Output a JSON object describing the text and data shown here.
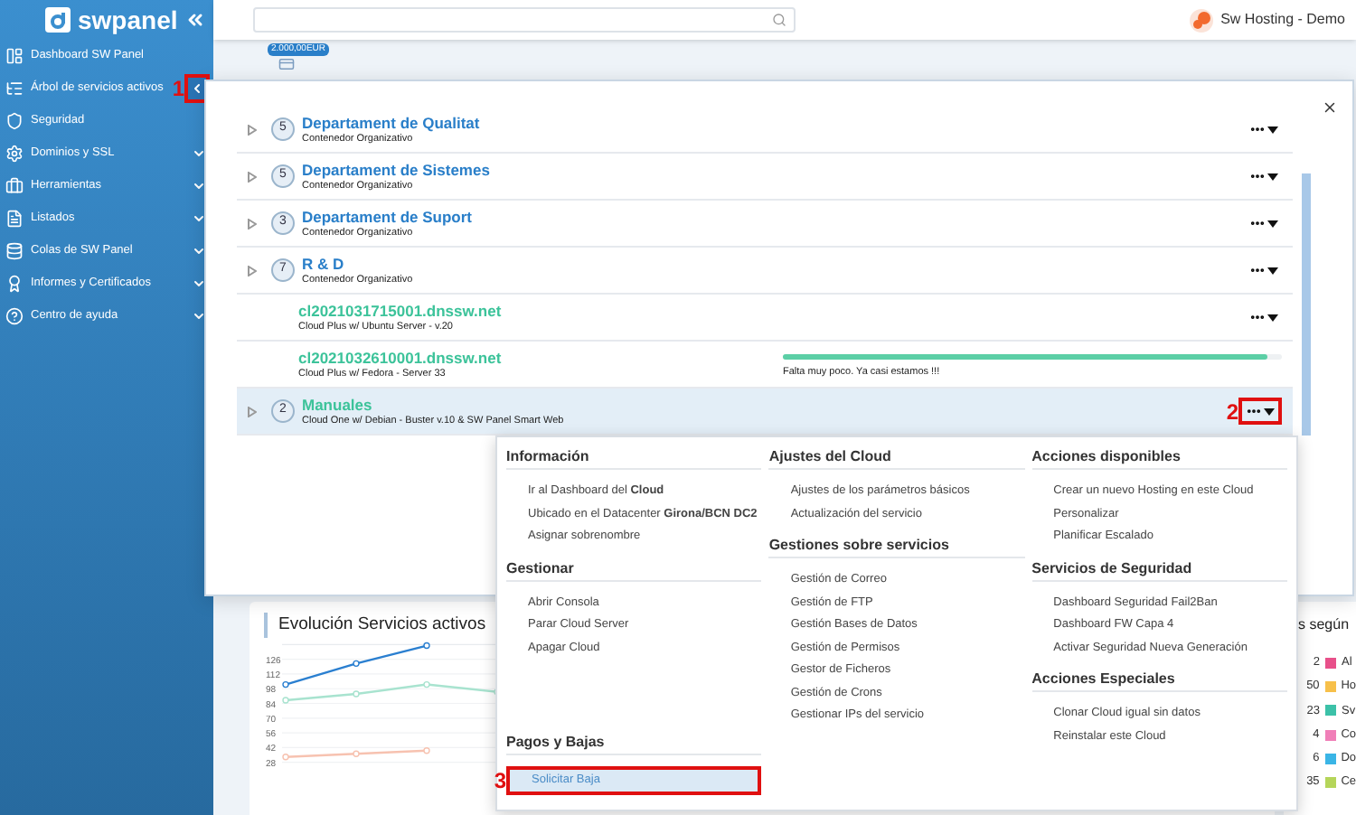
{
  "sidebar": {
    "logo": "swpanel",
    "items": [
      {
        "label": "Dashboard SW Panel",
        "expandable": false
      },
      {
        "label": "Árbol de servicios activos",
        "expandable": false,
        "annotation": "1"
      },
      {
        "label": "Seguridad",
        "expandable": false
      },
      {
        "label": "Dominios y SSL",
        "expandable": true
      },
      {
        "label": "Herramientas",
        "expandable": true
      },
      {
        "label": "Listados",
        "expandable": true
      },
      {
        "label": "Colas de SW Panel",
        "expandable": true
      },
      {
        "label": "Informes y Certificados",
        "expandable": true
      },
      {
        "label": "Centro de ayuda",
        "expandable": true
      }
    ]
  },
  "topbar": {
    "user": "Sw Hosting - Demo",
    "balance": "2.000,00EUR"
  },
  "modal": {
    "rows": [
      {
        "kind": "group",
        "count": "5",
        "title": "Departament de Qualitat",
        "subtitle": "Contenedor Organizativo",
        "selected": false
      },
      {
        "kind": "group",
        "count": "5",
        "title": "Departament de Sistemes",
        "subtitle": "Contenedor Organizativo",
        "selected": false
      },
      {
        "kind": "group",
        "count": "3",
        "title": "Departament de Suport",
        "subtitle": "Contenedor Organizativo",
        "selected": false
      },
      {
        "kind": "group",
        "count": "7",
        "title": "R & D",
        "subtitle": "Contenedor Organizativo",
        "selected": false
      },
      {
        "kind": "server",
        "title": "cl2021031715001.dnssw.net",
        "subtitle": "Cloud Plus w/ Ubuntu Server - v.20",
        "selected": false
      },
      {
        "kind": "server",
        "title": "cl2021032610001.dnssw.net",
        "subtitle": "Cloud Plus w/ Fedora - Server 33",
        "selected": false,
        "progress": {
          "level": 0.97,
          "message": "Falta muy poco. Ya casi estamos !!!"
        }
      },
      {
        "kind": "cloud",
        "count": "2",
        "title": "Manuales",
        "subtitle": "Cloud One w/ Debian - Buster v.10 & SW Panel Smart Web",
        "selected": true,
        "annotation": "2"
      }
    ]
  },
  "dropdown": {
    "columns": [
      {
        "sections": [
          {
            "title": "Información",
            "items": [
              {
                "label": "Ir al Dashboard del **Cloud**",
                "selected": false
              },
              {
                "label": "Ubicado en el Datacenter **Girona/BCN DC2**",
                "selected": false
              },
              {
                "label": "Asignar sobrenombre",
                "selected": false
              }
            ]
          },
          {
            "title": "Gestionar",
            "items": [
              {
                "label": "Abrir Consola",
                "selected": false
              },
              {
                "label": "Parar Cloud Server",
                "selected": false
              },
              {
                "label": "Apagar Cloud",
                "selected": false
              }
            ]
          },
          {
            "title": "Pagos y Bajas",
            "bottom": true,
            "items": [
              {
                "label": "Solicitar Baja",
                "selected": true,
                "annotation": "3"
              }
            ]
          }
        ]
      },
      {
        "sections": [
          {
            "title": "Ajustes del Cloud",
            "items": [
              {
                "label": "Ajustes de los parámetros básicos",
                "selected": false
              },
              {
                "label": "Actualización del servicio",
                "selected": false
              }
            ]
          },
          {
            "title": "Gestiones sobre servicios",
            "items": [
              {
                "label": "Gestión de Correo",
                "selected": false
              },
              {
                "label": "Gestión de FTP",
                "selected": false
              },
              {
                "label": "Gestión Bases de Datos",
                "selected": false
              },
              {
                "label": "Gestión de Permisos",
                "selected": false
              },
              {
                "label": "Gestor de Ficheros",
                "selected": false
              },
              {
                "label": "Gestión de Crons",
                "selected": false
              },
              {
                "label": "Gestionar IPs del servicio",
                "selected": false
              }
            ]
          }
        ]
      },
      {
        "sections": [
          {
            "title": "Acciones disponibles",
            "items": [
              {
                "label": "Crear un nuevo Hosting en este Cloud",
                "selected": false
              },
              {
                "label": "Personalizar",
                "selected": false
              },
              {
                "label": "Planificar Escalado",
                "selected": false
              }
            ]
          },
          {
            "title": "Servicios de Seguridad",
            "items": [
              {
                "label": "Dashboard Seguridad Fail2Ban",
                "selected": false
              },
              {
                "label": "Dashboard FW Capa 4",
                "selected": false
              },
              {
                "label": "Activar Seguridad Nueva Generación",
                "selected": false
              }
            ]
          },
          {
            "title": "Acciones Especiales",
            "items": [
              {
                "label": "Clonar Cloud igual sin datos",
                "selected": false
              },
              {
                "label": "Reinstalar este Cloud",
                "selected": false
              }
            ]
          }
        ]
      }
    ]
  },
  "dashboard": {
    "evolution": {
      "title": "Evolución Servicios activos",
      "chart_data": {
        "type": "line",
        "grid": true,
        "ylim": [
          28,
          140
        ],
        "yticks": [
          28,
          42,
          56,
          70,
          84,
          98,
          112,
          126
        ],
        "series": [
          {
            "color": "#2a7fd0",
            "marker": "circle",
            "values": [
              102,
              122,
              139,
              null
            ]
          },
          {
            "color": "#a8e3cf",
            "marker": "circle",
            "values": [
              87,
              93,
              102,
              95
            ]
          },
          {
            "color": "#f7c2b0",
            "marker": "circle",
            "values": [
              33,
              36,
              39,
              null
            ]
          }
        ]
      }
    },
    "distribution": {
      "title": "s según",
      "legend": [
        {
          "value": "2",
          "label": "Al",
          "color": "#e8508a"
        },
        {
          "value": "50",
          "label": "Ho",
          "color": "#f7c04a"
        },
        {
          "value": "23",
          "label": "Sv",
          "color": "#3cc1a8"
        },
        {
          "value": "4",
          "label": "Co",
          "color": "#f07fb8"
        },
        {
          "value": "6",
          "label": "Do",
          "color": "#3ab5e6"
        },
        {
          "value": "35",
          "label": "Ce",
          "color": "#b5d55a"
        }
      ]
    }
  }
}
